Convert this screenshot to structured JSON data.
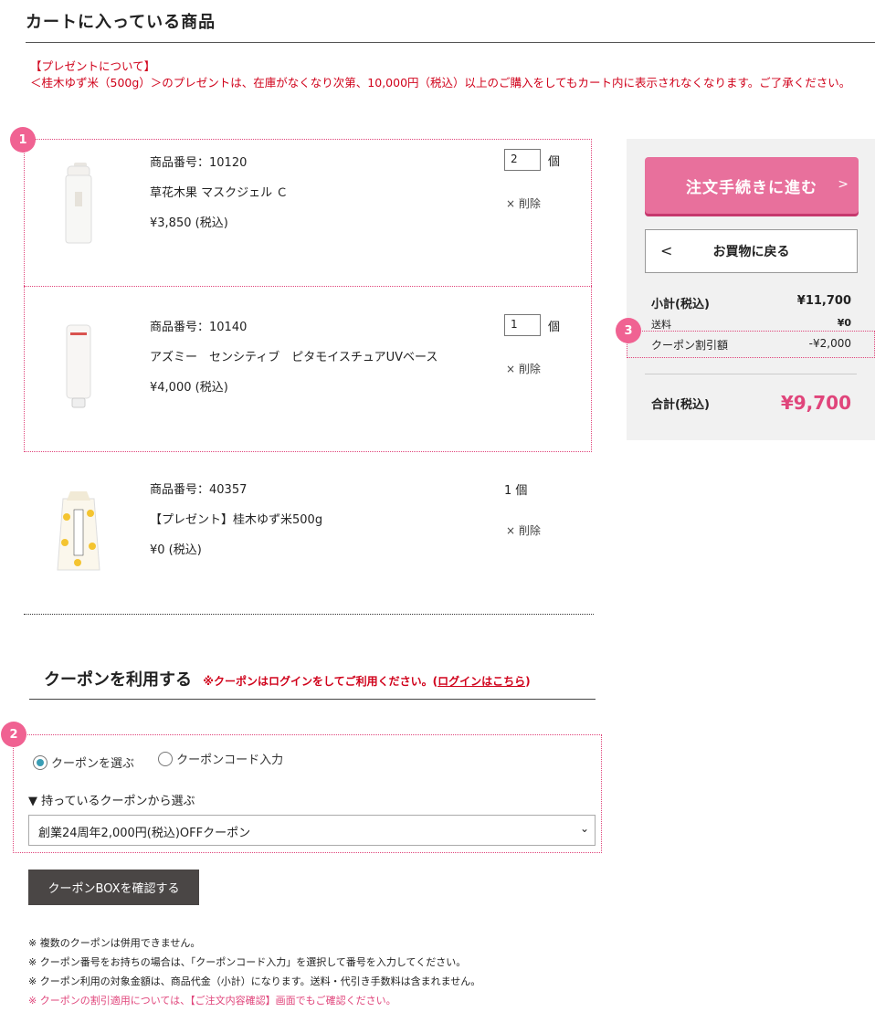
{
  "page_title": "カートに入っている商品",
  "notice": {
    "heading": "【プレゼントについて】",
    "body": "＜桂木ゆず米（500g）＞のプレゼントは、在庫がなくなり次第、10,000円（税込）以上のご購入をしてもカート内に表示されなくなります。ご了承ください。"
  },
  "badges": [
    "1",
    "2",
    "3"
  ],
  "cart_items": [
    {
      "code": "商品番号：10120",
      "name": "草花木果 マスクジェル Ｃ",
      "price": "¥3,850 (税込)",
      "qty_value": "2",
      "qty_unit": "個",
      "delete": "× 削除"
    },
    {
      "code": "商品番号：10140",
      "name": "アズミー　センシティブ　ピタモイスチュアUVベース",
      "price": "¥4,000 (税込)",
      "qty_value": "1",
      "qty_unit": "個",
      "delete": "× 削除"
    },
    {
      "code": "商品番号：40357",
      "name": "【プレゼント】桂木ゆず米500g",
      "price": "¥0 (税込)",
      "qty_text": "1 個",
      "delete": "× 削除"
    }
  ],
  "summary": {
    "order_button": "注文手続きに進む",
    "back_button": "お買物に戻る",
    "subtotal_label": "小計(税込)",
    "subtotal_value": "¥11,700",
    "shipping_label": "送料",
    "shipping_value": "¥0",
    "coupon_label": "クーポン割引額",
    "coupon_value": "-¥2,000",
    "total_label": "合計(税込)",
    "total_value": "¥9,700"
  },
  "coupon": {
    "title": "クーポンを利用する",
    "login_note": "※クーポンはログインをしてご利用ください。(",
    "login_link": "ログインはこちら",
    "login_note_end": ")",
    "radio_select": "クーポンを選ぶ",
    "radio_code": "クーポンコード入力",
    "select_heading": "▼ 持っているクーポンから選ぶ",
    "selected_coupon": "創業24周年2,000円(税込)OFFクーポン",
    "box_button": "クーポンBOXを確認する"
  },
  "notes": [
    "※ 複数のクーポンは併用できません。",
    "※ クーポン番号をお持ちの場合は、「クーポンコード入力」を選択して番号を入力してください。",
    "※ クーポン利用の対象金額は、商品代金（小計）になります。送料・代引き手数料は含まれません。",
    "※ クーポンの割引適用については、【ご注文内容確認】画面でもご確認ください。"
  ],
  "colors": {
    "accent": "#e8709c",
    "price_pink": "#e0457b",
    "notice_red": "#d0021b",
    "dark_button": "#4a4645"
  }
}
